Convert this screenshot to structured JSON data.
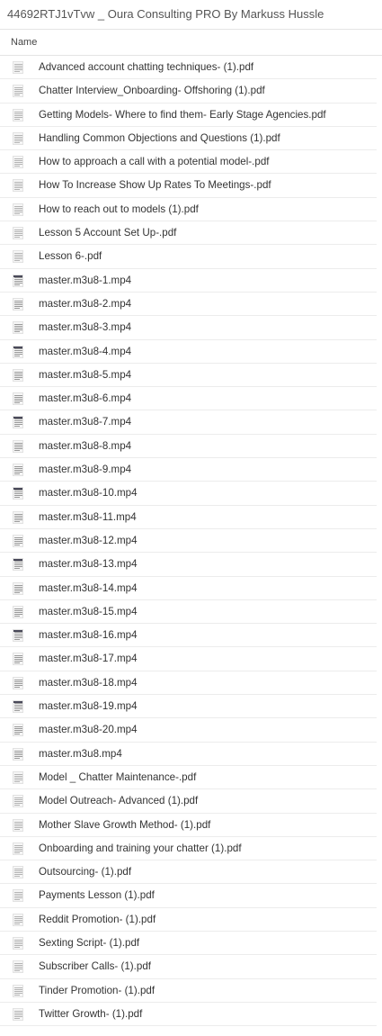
{
  "window": {
    "title": "44692RTJ1vTvw _ Oura Consulting PRO By Markuss Hussle"
  },
  "list_header": {
    "name_column": "Name"
  },
  "files": [
    {
      "name": "Advanced account chatting techniques- (1).pdf",
      "icon": "document-thumbnail-icon"
    },
    {
      "name": "Chatter Interview_Onboarding- Offshoring (1).pdf",
      "icon": "document-thumbnail-icon"
    },
    {
      "name": "Getting Models- Where to find them- Early Stage Agencies.pdf",
      "icon": "document-thumbnail-icon"
    },
    {
      "name": "Handling Common Objections and Questions (1).pdf",
      "icon": "document-thumbnail-icon"
    },
    {
      "name": "How to approach a call with a potential model-.pdf",
      "icon": "document-thumbnail-icon"
    },
    {
      "name": "How To Increase Show Up Rates To Meetings-.pdf",
      "icon": "document-thumbnail-icon"
    },
    {
      "name": "How to reach out to models (1).pdf",
      "icon": "document-thumbnail-icon"
    },
    {
      "name": "Lesson 5 Account Set Up-.pdf",
      "icon": "document-thumbnail-icon"
    },
    {
      "name": "Lesson 6-.pdf",
      "icon": "document-thumbnail-icon"
    },
    {
      "name": "master.m3u8-1.mp4",
      "icon": "video-thumbnail-icon"
    },
    {
      "name": "master.m3u8-2.mp4",
      "icon": "video-thumbnail-icon"
    },
    {
      "name": "master.m3u8-3.mp4",
      "icon": "video-thumbnail-icon"
    },
    {
      "name": "master.m3u8-4.mp4",
      "icon": "video-thumbnail-icon"
    },
    {
      "name": "master.m3u8-5.mp4",
      "icon": "video-thumbnail-icon"
    },
    {
      "name": "master.m3u8-6.mp4",
      "icon": "video-thumbnail-icon"
    },
    {
      "name": "master.m3u8-7.mp4",
      "icon": "video-thumbnail-icon"
    },
    {
      "name": "master.m3u8-8.mp4",
      "icon": "video-thumbnail-icon"
    },
    {
      "name": "master.m3u8-9.mp4",
      "icon": "video-thumbnail-icon"
    },
    {
      "name": "master.m3u8-10.mp4",
      "icon": "video-thumbnail-icon"
    },
    {
      "name": "master.m3u8-11.mp4",
      "icon": "video-thumbnail-icon"
    },
    {
      "name": "master.m3u8-12.mp4",
      "icon": "video-thumbnail-icon"
    },
    {
      "name": "master.m3u8-13.mp4",
      "icon": "video-thumbnail-icon"
    },
    {
      "name": "master.m3u8-14.mp4",
      "icon": "video-thumbnail-icon"
    },
    {
      "name": "master.m3u8-15.mp4",
      "icon": "video-thumbnail-icon"
    },
    {
      "name": "master.m3u8-16.mp4",
      "icon": "video-thumbnail-icon"
    },
    {
      "name": "master.m3u8-17.mp4",
      "icon": "video-thumbnail-icon"
    },
    {
      "name": "master.m3u8-18.mp4",
      "icon": "video-thumbnail-icon"
    },
    {
      "name": "master.m3u8-19.mp4",
      "icon": "video-thumbnail-icon"
    },
    {
      "name": "master.m3u8-20.mp4",
      "icon": "video-thumbnail-icon"
    },
    {
      "name": "master.m3u8.mp4",
      "icon": "video-thumbnail-icon"
    },
    {
      "name": "Model _ Chatter Maintenance-.pdf",
      "icon": "document-thumbnail-icon"
    },
    {
      "name": "Model Outreach- Advanced (1).pdf",
      "icon": "document-thumbnail-icon"
    },
    {
      "name": "Mother Slave Growth Method- (1).pdf",
      "icon": "document-thumbnail-icon"
    },
    {
      "name": "Onboarding and training your chatter (1).pdf",
      "icon": "document-thumbnail-icon"
    },
    {
      "name": "Outsourcing- (1).pdf",
      "icon": "document-thumbnail-icon"
    },
    {
      "name": "Payments Lesson (1).pdf",
      "icon": "document-thumbnail-icon"
    },
    {
      "name": "Reddit Promotion- (1).pdf",
      "icon": "document-thumbnail-icon"
    },
    {
      "name": "Sexting Script- (1).pdf",
      "icon": "document-thumbnail-icon"
    },
    {
      "name": "Subscriber Calls- (1).pdf",
      "icon": "document-thumbnail-icon"
    },
    {
      "name": "Tinder Promotion- (1).pdf",
      "icon": "document-thumbnail-icon"
    },
    {
      "name": "Twitter Growth- (1).pdf",
      "icon": "document-thumbnail-icon"
    }
  ]
}
